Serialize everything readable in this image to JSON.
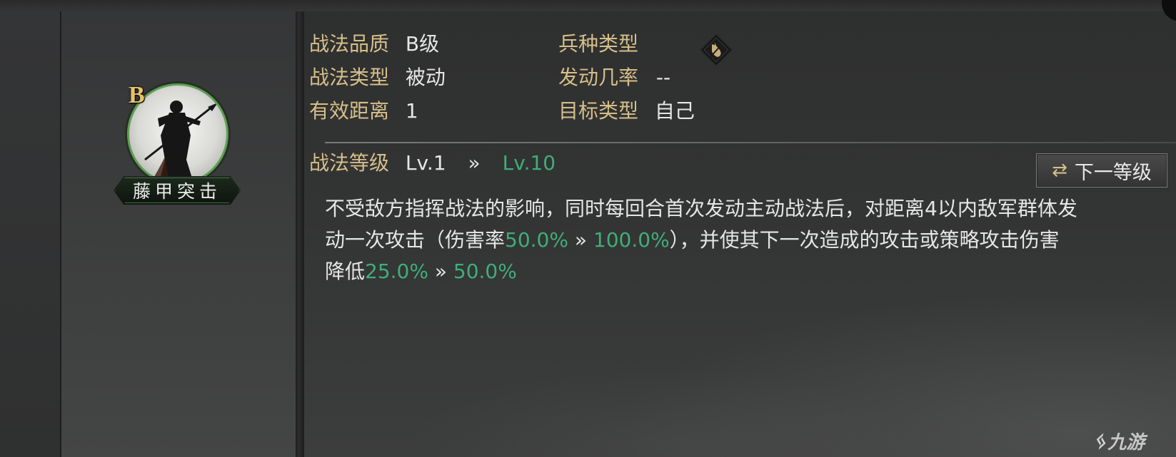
{
  "skill": {
    "grade": "B",
    "name": "藤甲突击"
  },
  "info": {
    "quality_label": "战法品质",
    "quality_value": "B级",
    "type_label": "战法类型",
    "type_value": "被动",
    "range_label": "有效距离",
    "range_value": "1",
    "troop_label": "兵种类型",
    "troop_icon": "troop-type-icon",
    "rate_label": "发动几率",
    "rate_value": "--",
    "target_label": "目标类型",
    "target_value": "自己"
  },
  "level": {
    "label": "战法等级",
    "current": "Lv.1",
    "arrow": "»",
    "next": "Lv.10",
    "button_label": "下一等级",
    "button_icon": "swap-arrows-icon"
  },
  "description": {
    "line1": "不受敌方指挥战法的影响，同时每回合首次发动主动战法后，对距离4以内敌军群体发",
    "line2_a": "动一次攻击（伤害率",
    "dmg_from": "50.0%",
    "arrow1": " » ",
    "dmg_to": "100.0%",
    "line2_b": "），并使其下一次造成的攻击或策略攻击伤害",
    "line3_a": "降低",
    "red_from": "25.0%",
    "arrow2": " » ",
    "red_to": "50.0%"
  },
  "watermark": {
    "text": "九游"
  },
  "colors": {
    "label_gold": "#d6bf8a",
    "value_green": "#3fae7a",
    "grade_gold": "#e8c36a",
    "ring_green": "#5e9e55"
  }
}
